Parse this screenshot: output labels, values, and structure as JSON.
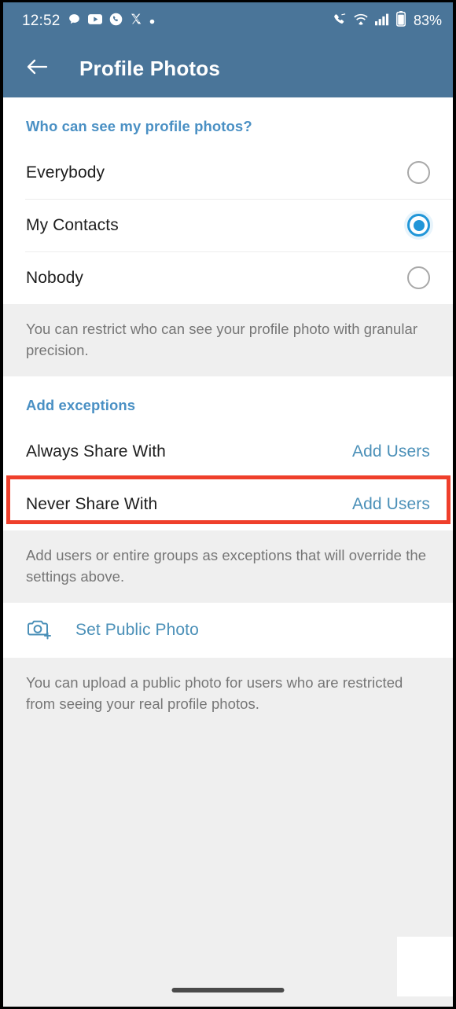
{
  "statusbar": {
    "time": "12:52",
    "battery_percent": "83%",
    "left_icons": [
      "message-bubble-icon",
      "youtube-icon",
      "phone-circle-icon",
      "x-twitter-icon",
      "dot-icon"
    ],
    "right_icons": [
      "call-muted-icon",
      "wifi-icon",
      "signal-bars-icon",
      "battery-icon"
    ]
  },
  "appbar": {
    "title": "Profile Photos",
    "back_icon": "arrow-left-icon"
  },
  "visibility_section": {
    "header": "Who can see my profile photos?",
    "options": [
      {
        "label": "Everybody",
        "selected": false
      },
      {
        "label": "My Contacts",
        "selected": true
      },
      {
        "label": "Nobody",
        "selected": false
      }
    ],
    "note": "You can restrict who can see your profile photo with granular precision."
  },
  "exceptions_section": {
    "header": "Add exceptions",
    "rows": [
      {
        "label": "Always Share With",
        "action": "Add Users",
        "highlighted": false
      },
      {
        "label": "Never Share With",
        "action": "Add Users",
        "highlighted": true
      }
    ],
    "note": "Add users or entire groups as exceptions that will override the settings above."
  },
  "public_photo_section": {
    "icon": "camera-add-icon",
    "label": "Set Public Photo",
    "note": "You can upload a public photo for users who are restricted from seeing your real profile photos."
  },
  "colors": {
    "appbar": "#4a7599",
    "accent_blue": "#4b90b8",
    "header_blue": "#4a90c4",
    "radio_selected": "#2196d8",
    "highlight_red": "#ef3f2b",
    "page_bg": "#efefef"
  }
}
